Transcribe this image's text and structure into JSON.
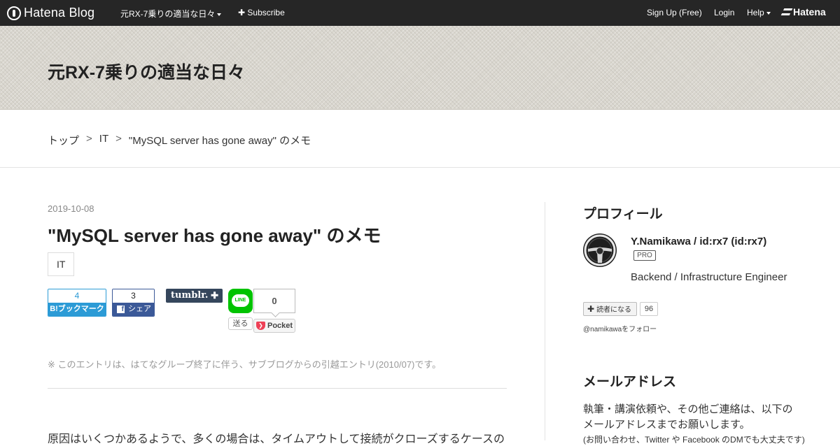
{
  "globalbar": {
    "brand": "Hatena Blog",
    "blog_menu": "元RX-7乗りの適当な日々",
    "subscribe": "Subscribe",
    "signup": "Sign Up (Free)",
    "login": "Login",
    "help": "Help",
    "hatena": "Hatena"
  },
  "header": {
    "blog_title": "元RX-7乗りの適当な日々"
  },
  "breadcrumb": {
    "top": "トップ",
    "category": "IT",
    "current": "\"MySQL server has gone away\" のメモ",
    "separator": ">"
  },
  "entry": {
    "date": "2019-10-08",
    "title": "\"MySQL server has gone away\" のメモ",
    "category": "IT",
    "note": "※ このエントリは、はてなグループ終了に伴う、サブブログからの引越エントリ(2010/07)です。",
    "body_first_line": "原因はいくつかあるようで、多くの場合は、タイムアウトして接続がクローズするケースの"
  },
  "share": {
    "hatena_count": "4",
    "hatena_label": "B!ブックマーク",
    "facebook_count": "3",
    "facebook_label": "シェア",
    "tumblr_label": "tumblr.",
    "tumblr_plus": "✚",
    "line_label": "LINE",
    "line_send": "送る",
    "pocket_count": "0",
    "pocket_label": "Pocket"
  },
  "sidebar": {
    "profile_heading": "プロフィール",
    "profile_name": "Y.Namikawa / id:rx7 (id:rx7)",
    "pro_badge": "PRO",
    "profile_desc": "Backend / Infrastructure Engineer",
    "reader_button": "読者になる",
    "reader_count": "96",
    "follow_text": "@namikawaをフォロー",
    "mail_heading": "メールアドレス",
    "mail_text": "執筆・講演依頼や、その他ご連絡は、以下のメールアドレスまでお願いします。",
    "mail_text_3": "(お問い合わせ、Twitter や Facebook のDMでも大丈夫です)"
  },
  "colors": {
    "topbar": "#262626",
    "hatena_blue": "#2c9bd6",
    "facebook": "#3b5998",
    "tumblr": "#35465c",
    "line": "#00c300",
    "pocket": "#ee4056"
  }
}
